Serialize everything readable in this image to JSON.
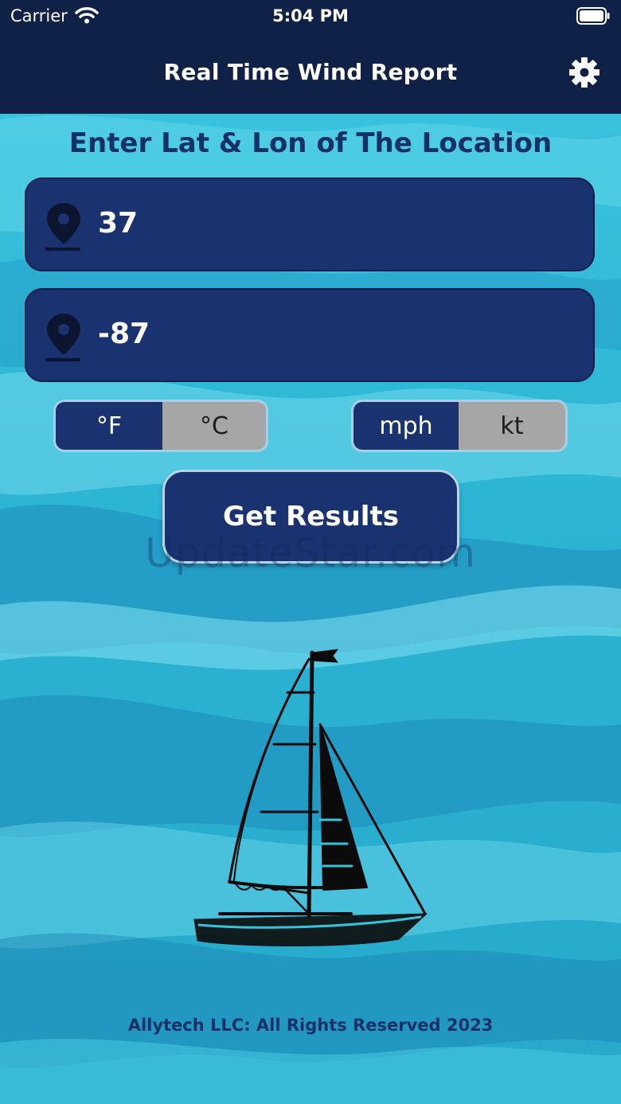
{
  "status_bar": {
    "carrier": "Carrier",
    "time": "5:04 PM"
  },
  "nav": {
    "title": "Real Time Wind Report",
    "settings_icon": "gear-icon"
  },
  "prompt": "Enter Lat & Lon of The Location",
  "latitude": {
    "value": "37",
    "icon": "location-pin-icon"
  },
  "longitude": {
    "value": "-87",
    "icon": "location-pin-icon"
  },
  "temp_unit": {
    "options": [
      "°F",
      "°C"
    ],
    "selected": "°F"
  },
  "speed_unit": {
    "options": [
      "mph",
      "kt"
    ],
    "selected": "mph"
  },
  "get_results_label": "Get Results",
  "watermark": "UpdateStar.com",
  "footer": "Allytech LLC: All Rights Reserved 2023",
  "colors": {
    "nav_background": "#0f2147",
    "accent_navy": "#1a3370",
    "ocean": "#2bb7d6",
    "prompt_text": "#143166",
    "segment_unselected": "#a6a6a6"
  }
}
